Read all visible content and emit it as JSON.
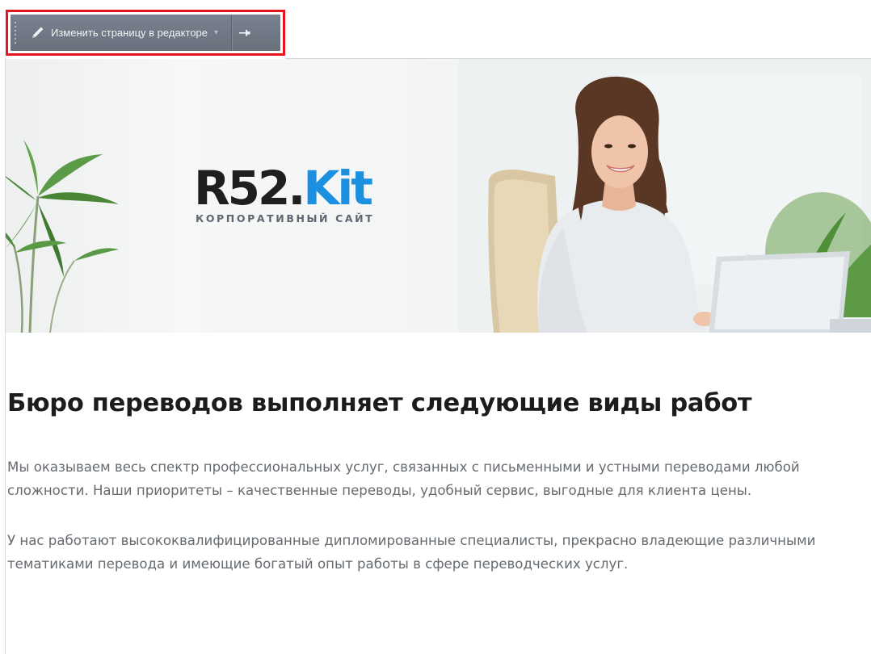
{
  "toolbar": {
    "edit_label": "Изменить страницу в редакторе",
    "caret": "▾",
    "pin_icon": "pin-icon",
    "pencil_icon": "pencil-icon",
    "highlight_color": "#e3141b"
  },
  "hero": {
    "logo_main_dark": "R52.",
    "logo_main_blue": "Kit",
    "logo_sub": "КОРПОРАТИВНЫЙ САЙТ",
    "brand_blue": "#1b8fe0"
  },
  "content": {
    "heading": "Бюро переводов выполняет следующие виды работ",
    "paragraphs": [
      "Мы оказываем весь спектр профессиональных  услуг,  связанных с письменными и устными переводами любой сложности. Наши приоритеты – качественные переводы, удобный сервис, выгодные для клиента цены.",
      "У нас работают высококвалифицированные дипломированные специалисты, прекрасно владеющие различными тематиками перевода и имеющие богатый опыт работы в сфере переводческих услуг."
    ]
  }
}
